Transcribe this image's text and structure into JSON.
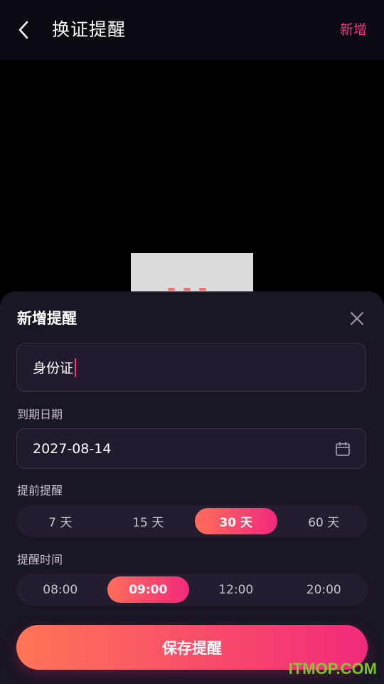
{
  "header": {
    "title": "换证提醒",
    "action_label": "新增"
  },
  "sheet": {
    "title": "新增提醒",
    "name_value": "身份证",
    "expiry_label": "到期日期",
    "expiry_value": "2027-08-14",
    "advance_label": "提前提醒",
    "advance_options": [
      "7 天",
      "15 天",
      "30 天",
      "60 天"
    ],
    "advance_selected": "30 天",
    "time_label": "提醒时间",
    "time_options": [
      "08:00",
      "09:00",
      "12:00",
      "20:00"
    ],
    "time_selected": "09:00",
    "save_label": "保存提醒"
  },
  "watermark": "ITMOP.COM",
  "colors": {
    "accent": "#ff2e7e",
    "gradient_start": "#ff6e5a",
    "gradient_end": "#f2297c",
    "sheet_bg": "#1b1623",
    "input_bg": "#221b2e"
  },
  "icons": [
    "back-arrow-icon",
    "close-icon",
    "calendar-icon"
  ]
}
